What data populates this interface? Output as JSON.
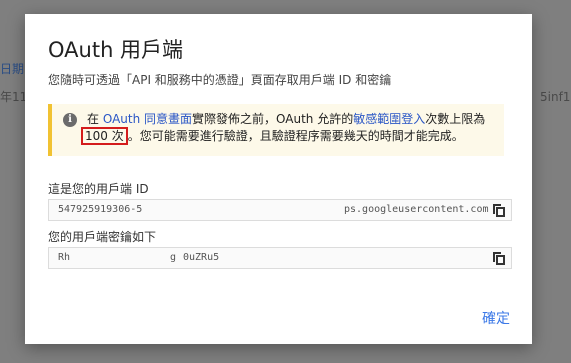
{
  "background": {
    "left_fragment_1": "日期",
    "left_fragment_2": "年11",
    "right_fragment": "5inf175"
  },
  "dialog": {
    "title": "OAuth 用戶端",
    "subtitle": "您隨時可透過「API 和服務中的憑證」頁面存取用戶端 ID 和密鑰",
    "notice": {
      "prefix": "在 ",
      "consent_link": "OAuth 同意畫面",
      "mid1": "實際發佈之前，OAuth 允許的",
      "scope_link": "敏感範圍登入",
      "mid2": "次數上限為",
      "limit": "100 次",
      "suffix": "。您可能需要進行驗證，且驗證程序需要幾天的時間才能完成。"
    },
    "client_id": {
      "label": "這是您的用戶端 ID",
      "value_start": "547925919306-5",
      "value_end": "ps.googleusercontent.com"
    },
    "client_secret": {
      "label": "您的用戶端密鑰如下",
      "value_start": "Rh",
      "value_mid": "g",
      "value_end": "0uZRu5"
    },
    "ok_label": "確定"
  },
  "colors": {
    "accent": "#3b78e7",
    "notice_bar": "#f1c232",
    "highlight": "#d41c1c"
  }
}
